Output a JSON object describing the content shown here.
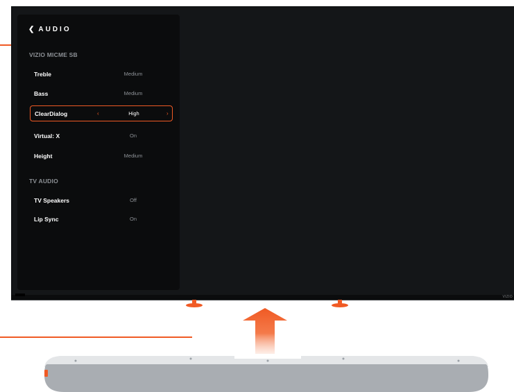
{
  "menu": {
    "title": "AUDIO",
    "back_icon": "chevron-left-icon",
    "sections": [
      {
        "title": "VIZIO MICME SB",
        "items": [
          {
            "label": "Treble",
            "value": "Medium",
            "selected": false
          },
          {
            "label": "Bass",
            "value": "Medium",
            "selected": false
          },
          {
            "label": "ClearDialog",
            "value": "High",
            "selected": true
          },
          {
            "label": "Virtual: X",
            "value": "On",
            "selected": false
          },
          {
            "label": "Height",
            "value": "Medium",
            "selected": false
          }
        ]
      },
      {
        "title": "TV AUDIO",
        "items": [
          {
            "label": "TV Speakers",
            "value": "Off",
            "selected": false
          },
          {
            "label": "Lip Sync",
            "value": "On",
            "selected": false
          }
        ]
      }
    ]
  },
  "tv": {
    "logo": "VIZIO"
  },
  "colors": {
    "accent": "#f05a24",
    "tv_body": "#101214",
    "menu_bg": "#0b0c0d",
    "soundbar": "#a9adb2",
    "soundbar_top": "#e4e6e8"
  }
}
